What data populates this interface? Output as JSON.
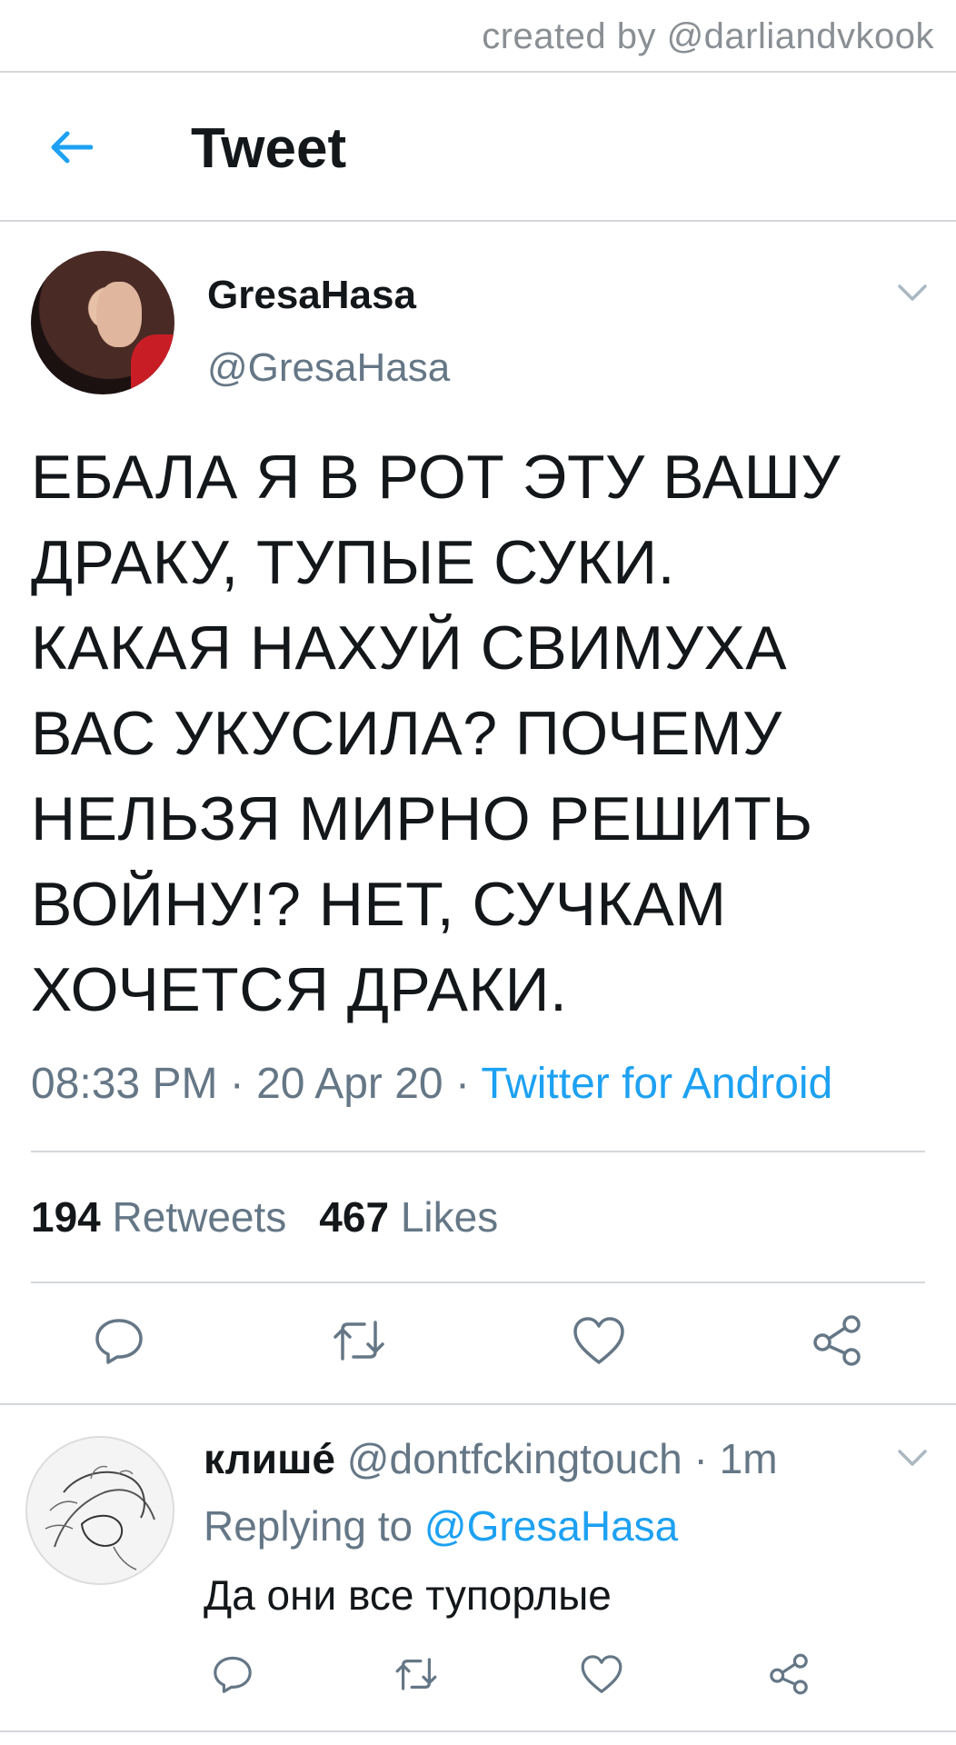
{
  "credit": "created by @darliandvkook",
  "header": {
    "title": "Tweet"
  },
  "tweet": {
    "author_name": "GresaHasa",
    "author_handle": "@GresaHasa",
    "text_lines": [
      "ЕБАЛА Я В РОТ ЭТУ ВАШУ",
      "ДРАКУ, ТУПЫЕ СУКИ.",
      "КАКАЯ НАХУЙ СВИМУХА",
      "ВАС УКУСИЛА? ПОЧЕМУ",
      "НЕЛЬЗЯ МИРНО РЕШИТЬ",
      "ВОЙНУ!? НЕТ, СУЧКАМ",
      "ХОЧЕТСЯ ДРАКИ."
    ],
    "time": "08:33 PM",
    "date": "20 Apr 20",
    "source": "Twitter for Android",
    "separator": " · ",
    "retweets_count": "194",
    "retweets_label": "Retweets",
    "likes_count": "467",
    "likes_label": "Likes"
  },
  "reply": {
    "name": "клишé",
    "handle": "@dontfckingtouch",
    "time": "1m",
    "replying_prefix": "Replying to",
    "replying_to": "@GresaHasa",
    "text": "Да они все тупорлые"
  },
  "icons": {
    "back": "arrow-left-icon",
    "caret": "chevron-down-icon",
    "reply": "comment-icon",
    "retweet": "retweet-icon",
    "like": "heart-icon",
    "share": "share-icon"
  },
  "colors": {
    "accent": "#1da1f2",
    "text": "#14171a",
    "secondary": "#657786",
    "divider": "#d4d7da"
  }
}
